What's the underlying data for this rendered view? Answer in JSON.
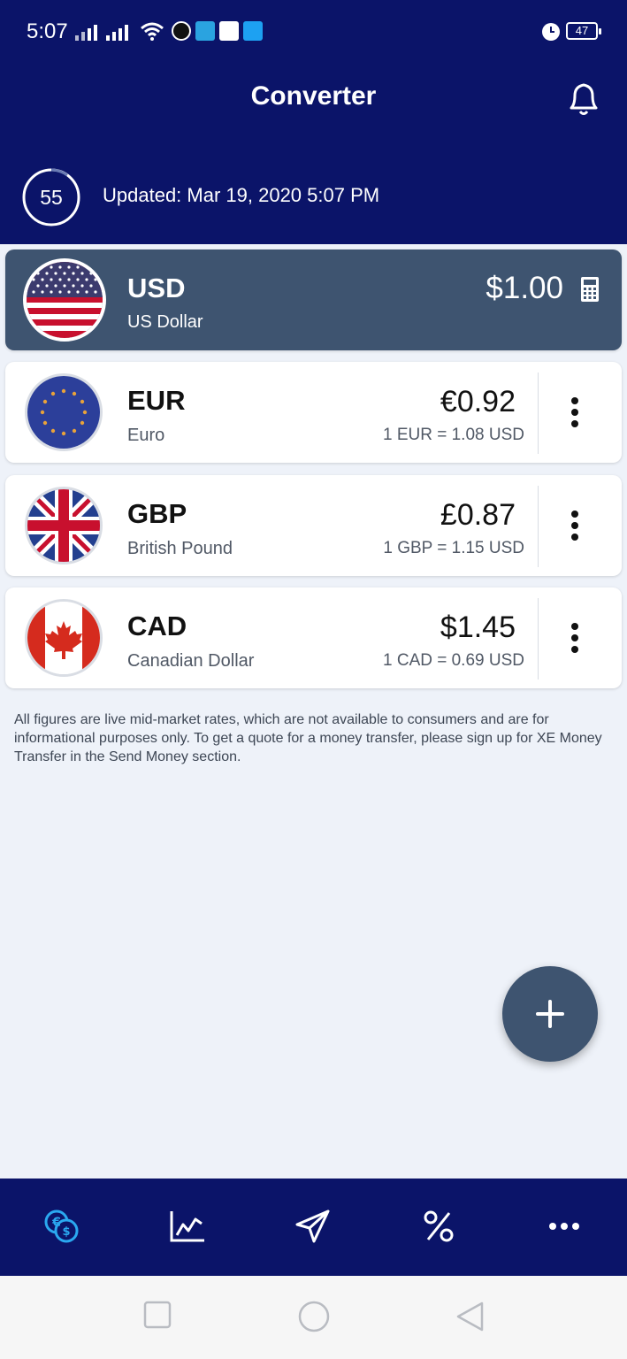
{
  "status_bar": {
    "time": "5:07",
    "battery": "47"
  },
  "header": {
    "title": "Converter",
    "refresh_countdown": "55",
    "updated": "Updated: Mar 19, 2020 5:07 PM"
  },
  "base_currency": {
    "code": "USD",
    "name": "US Dollar",
    "amount": "$1.00",
    "flag_icon": "us-flag-icon"
  },
  "currencies": [
    {
      "code": "EUR",
      "name": "Euro",
      "amount": "€0.92",
      "rate": "1 EUR = 1.08 USD",
      "flag_icon": "eu-flag-icon"
    },
    {
      "code": "GBP",
      "name": "British Pound",
      "amount": "£0.87",
      "rate": "1 GBP = 1.15 USD",
      "flag_icon": "uk-flag-icon"
    },
    {
      "code": "CAD",
      "name": "Canadian Dollar",
      "amount": "$1.45",
      "rate": "1 CAD = 0.69 USD",
      "flag_icon": "canada-flag-icon"
    }
  ],
  "disclaimer": "All figures are live mid-market rates, which are not available to consumers and are for informational purposes only. To get a quote for a money transfer, please sign up for XE Money Transfer in the Send Money section.",
  "bottom_nav": {
    "items": [
      "converter-icon",
      "charts-icon",
      "send-money-icon",
      "rate-alerts-icon",
      "more-icon"
    ],
    "active_index": 0
  },
  "colors": {
    "header_bg": "#0b1469",
    "base_card_bg": "#3e5470",
    "active_nav": "#2aa8f0",
    "page_bg": "#eef2f9"
  }
}
